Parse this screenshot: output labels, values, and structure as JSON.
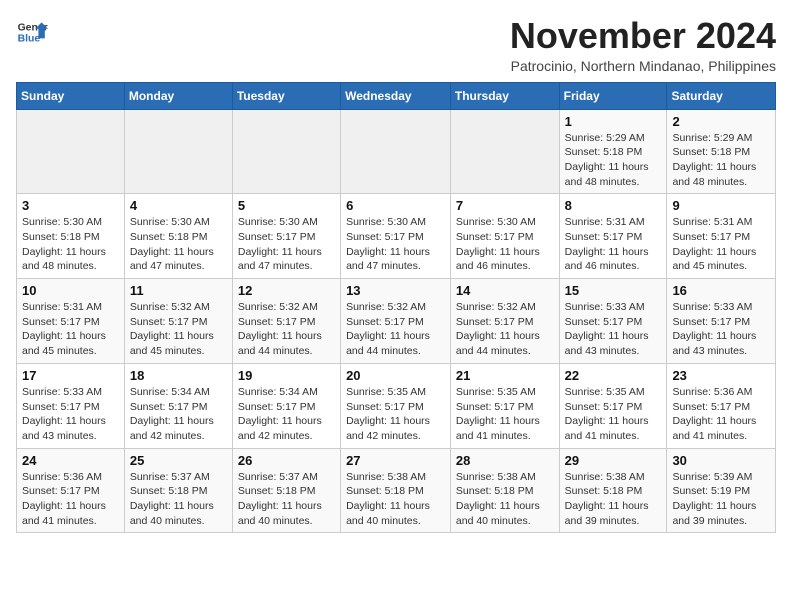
{
  "header": {
    "logo_general": "General",
    "logo_blue": "Blue",
    "month_title": "November 2024",
    "subtitle": "Patrocinio, Northern Mindanao, Philippines"
  },
  "days_of_week": [
    "Sunday",
    "Monday",
    "Tuesday",
    "Wednesday",
    "Thursday",
    "Friday",
    "Saturday"
  ],
  "weeks": [
    [
      {
        "day": "",
        "info": ""
      },
      {
        "day": "",
        "info": ""
      },
      {
        "day": "",
        "info": ""
      },
      {
        "day": "",
        "info": ""
      },
      {
        "day": "",
        "info": ""
      },
      {
        "day": "1",
        "info": "Sunrise: 5:29 AM\nSunset: 5:18 PM\nDaylight: 11 hours and 48 minutes."
      },
      {
        "day": "2",
        "info": "Sunrise: 5:29 AM\nSunset: 5:18 PM\nDaylight: 11 hours and 48 minutes."
      }
    ],
    [
      {
        "day": "3",
        "info": "Sunrise: 5:30 AM\nSunset: 5:18 PM\nDaylight: 11 hours and 48 minutes."
      },
      {
        "day": "4",
        "info": "Sunrise: 5:30 AM\nSunset: 5:18 PM\nDaylight: 11 hours and 47 minutes."
      },
      {
        "day": "5",
        "info": "Sunrise: 5:30 AM\nSunset: 5:17 PM\nDaylight: 11 hours and 47 minutes."
      },
      {
        "day": "6",
        "info": "Sunrise: 5:30 AM\nSunset: 5:17 PM\nDaylight: 11 hours and 47 minutes."
      },
      {
        "day": "7",
        "info": "Sunrise: 5:30 AM\nSunset: 5:17 PM\nDaylight: 11 hours and 46 minutes."
      },
      {
        "day": "8",
        "info": "Sunrise: 5:31 AM\nSunset: 5:17 PM\nDaylight: 11 hours and 46 minutes."
      },
      {
        "day": "9",
        "info": "Sunrise: 5:31 AM\nSunset: 5:17 PM\nDaylight: 11 hours and 45 minutes."
      }
    ],
    [
      {
        "day": "10",
        "info": "Sunrise: 5:31 AM\nSunset: 5:17 PM\nDaylight: 11 hours and 45 minutes."
      },
      {
        "day": "11",
        "info": "Sunrise: 5:32 AM\nSunset: 5:17 PM\nDaylight: 11 hours and 45 minutes."
      },
      {
        "day": "12",
        "info": "Sunrise: 5:32 AM\nSunset: 5:17 PM\nDaylight: 11 hours and 44 minutes."
      },
      {
        "day": "13",
        "info": "Sunrise: 5:32 AM\nSunset: 5:17 PM\nDaylight: 11 hours and 44 minutes."
      },
      {
        "day": "14",
        "info": "Sunrise: 5:32 AM\nSunset: 5:17 PM\nDaylight: 11 hours and 44 minutes."
      },
      {
        "day": "15",
        "info": "Sunrise: 5:33 AM\nSunset: 5:17 PM\nDaylight: 11 hours and 43 minutes."
      },
      {
        "day": "16",
        "info": "Sunrise: 5:33 AM\nSunset: 5:17 PM\nDaylight: 11 hours and 43 minutes."
      }
    ],
    [
      {
        "day": "17",
        "info": "Sunrise: 5:33 AM\nSunset: 5:17 PM\nDaylight: 11 hours and 43 minutes."
      },
      {
        "day": "18",
        "info": "Sunrise: 5:34 AM\nSunset: 5:17 PM\nDaylight: 11 hours and 42 minutes."
      },
      {
        "day": "19",
        "info": "Sunrise: 5:34 AM\nSunset: 5:17 PM\nDaylight: 11 hours and 42 minutes."
      },
      {
        "day": "20",
        "info": "Sunrise: 5:35 AM\nSunset: 5:17 PM\nDaylight: 11 hours and 42 minutes."
      },
      {
        "day": "21",
        "info": "Sunrise: 5:35 AM\nSunset: 5:17 PM\nDaylight: 11 hours and 41 minutes."
      },
      {
        "day": "22",
        "info": "Sunrise: 5:35 AM\nSunset: 5:17 PM\nDaylight: 11 hours and 41 minutes."
      },
      {
        "day": "23",
        "info": "Sunrise: 5:36 AM\nSunset: 5:17 PM\nDaylight: 11 hours and 41 minutes."
      }
    ],
    [
      {
        "day": "24",
        "info": "Sunrise: 5:36 AM\nSunset: 5:17 PM\nDaylight: 11 hours and 41 minutes."
      },
      {
        "day": "25",
        "info": "Sunrise: 5:37 AM\nSunset: 5:18 PM\nDaylight: 11 hours and 40 minutes."
      },
      {
        "day": "26",
        "info": "Sunrise: 5:37 AM\nSunset: 5:18 PM\nDaylight: 11 hours and 40 minutes."
      },
      {
        "day": "27",
        "info": "Sunrise: 5:38 AM\nSunset: 5:18 PM\nDaylight: 11 hours and 40 minutes."
      },
      {
        "day": "28",
        "info": "Sunrise: 5:38 AM\nSunset: 5:18 PM\nDaylight: 11 hours and 40 minutes."
      },
      {
        "day": "29",
        "info": "Sunrise: 5:38 AM\nSunset: 5:18 PM\nDaylight: 11 hours and 39 minutes."
      },
      {
        "day": "30",
        "info": "Sunrise: 5:39 AM\nSunset: 5:19 PM\nDaylight: 11 hours and 39 minutes."
      }
    ]
  ]
}
